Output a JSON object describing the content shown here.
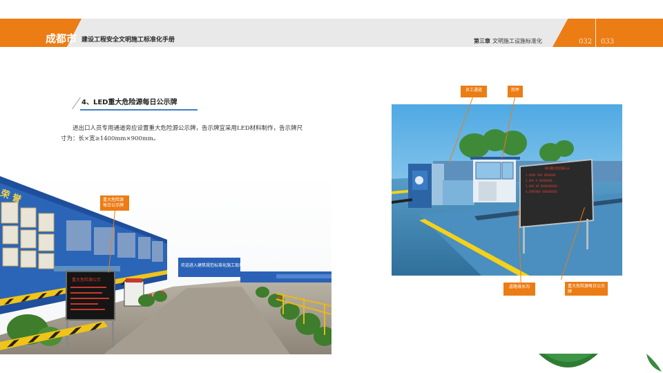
{
  "header": {
    "logo": "成都市",
    "title": "建设工程安全文明施工标准化手册",
    "chapter": "第三章",
    "chapter_sub": "文明施工设施标准化",
    "page_left": "032",
    "page_right": "033"
  },
  "section": {
    "title": "4、LED重大危险源每日公示牌",
    "body": "进出口人员专用通道旁应设置重大危险源公示牌，告示牌宜采用LED材料制作，告示牌尺寸为：长×宽≥1400mm×900mm。"
  },
  "left_photo": {
    "callout": "重大危险源每日公示牌",
    "wall_banner": "欢迎进入建筑规范标准化施工现场",
    "wall_header": "荣 誉",
    "led_text": "重大危险源公示"
  },
  "right_photo": {
    "callouts": [
      "员工通道",
      "岗亭",
      "道路排水沟",
      "重大危险源每日公示牌"
    ],
    "board_title": "每日重大危险源公示",
    "board_lines": [
      "1.XXXX XXX XXXXXXX",
      "2.XXX X XXXXXXXX",
      "3.XXX XX XXXXXXXXXX",
      "4.XXXXXXX XXXXXXXXX"
    ]
  },
  "colors": {
    "accent": "#ec7c14",
    "header_bg": "#e9e9e9",
    "rule": "#3a7fc1"
  }
}
